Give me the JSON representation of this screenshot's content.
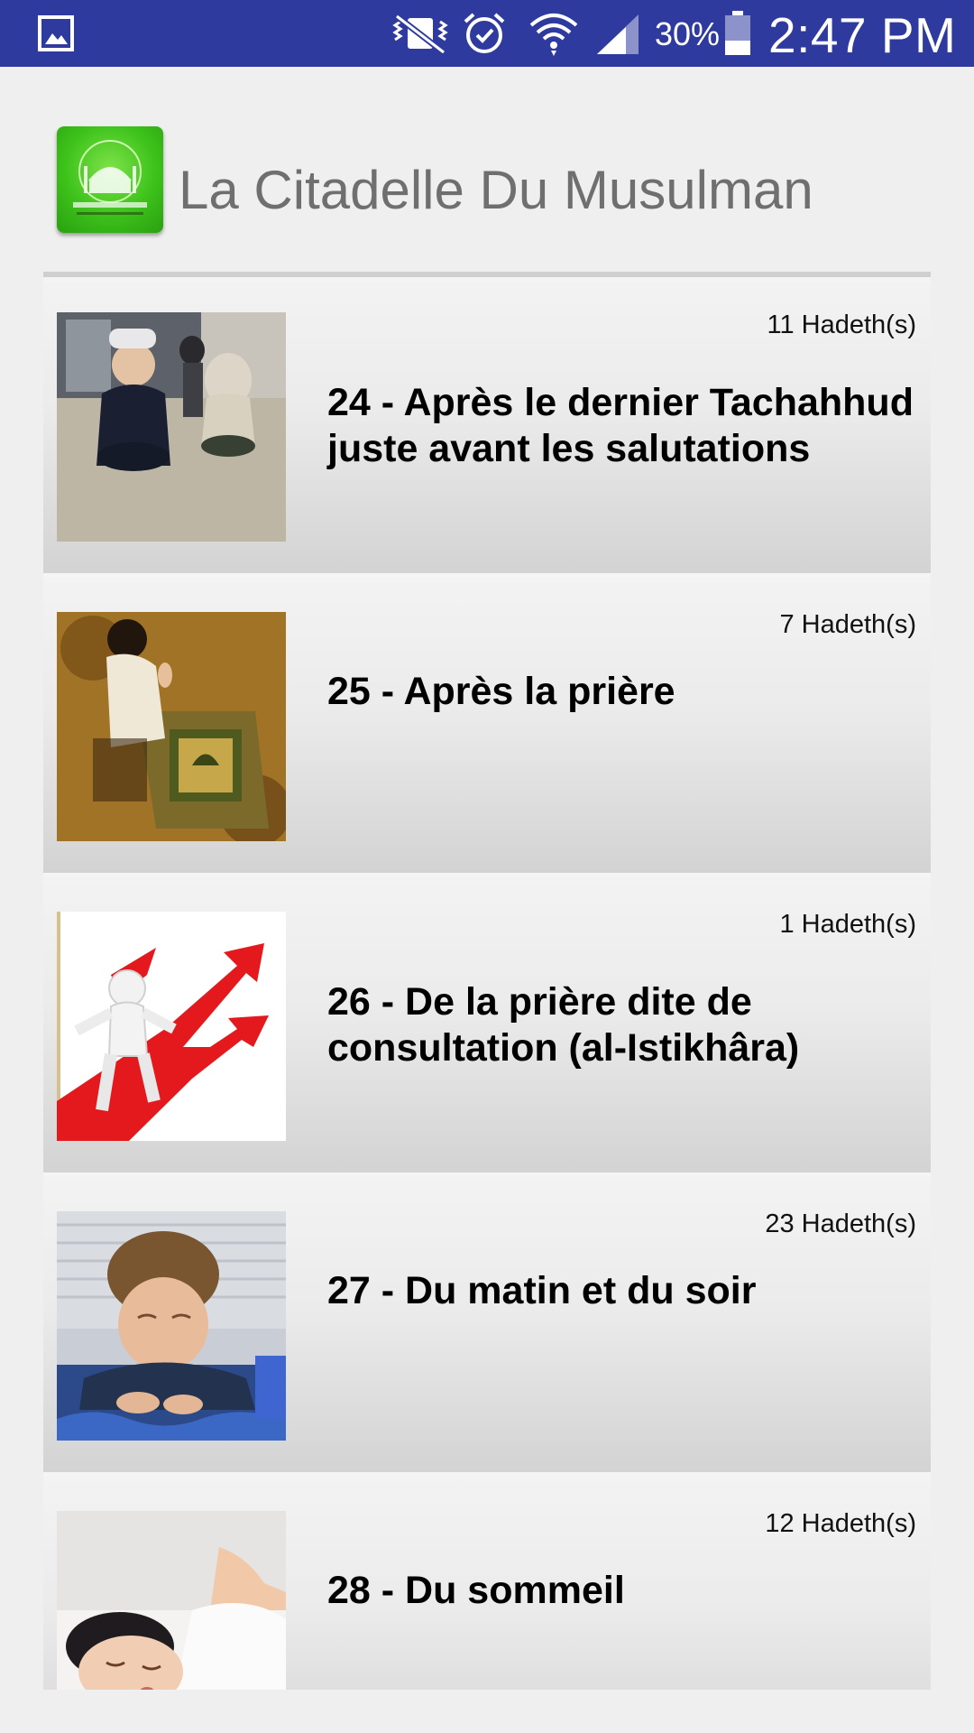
{
  "status_bar": {
    "battery_percent": "30%",
    "time": "2:47 PM",
    "background_color": "#2f3a9f",
    "icons": [
      "gallery-icon",
      "vibrate-mute-icon",
      "alarm-icon",
      "wifi-icon",
      "cell-signal-icon",
      "battery-icon"
    ]
  },
  "header": {
    "title": "La Citadelle Du Musulman",
    "logo_icon": "mosque-logo-icon"
  },
  "chapters": [
    {
      "count": "11 Hadeth(s)",
      "title": "24 - Après le dernier Tachahhud juste avant les salutations",
      "thumb_icon": "children-praying-image"
    },
    {
      "count": "7 Hadeth(s)",
      "title": "25 - Après la prière",
      "thumb_icon": "child-prayer-rug-image"
    },
    {
      "count": "1 Hadeth(s)",
      "title": "26 - De la prière dite de consultation (al-Istikhâra)",
      "thumb_icon": "crossroad-arrows-image"
    },
    {
      "count": "23 Hadeth(s)",
      "title": "27 - Du matin et du soir",
      "thumb_icon": "sleepy-child-morning-image"
    },
    {
      "count": "12 Hadeth(s)",
      "title": "28 - Du sommeil",
      "thumb_icon": "sleeping-child-image"
    }
  ]
}
